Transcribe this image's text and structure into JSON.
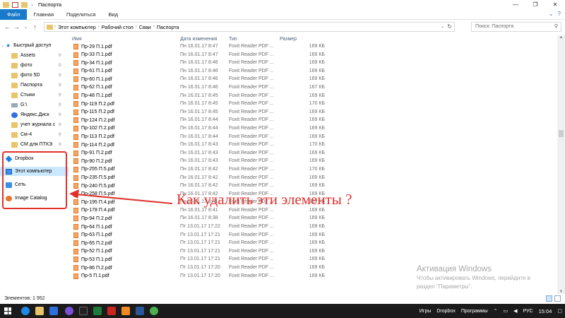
{
  "window": {
    "title": "Паспорта",
    "controls": [
      "—",
      "❐",
      "✕"
    ]
  },
  "ribbon": {
    "tabs": [
      "Файл",
      "Главная",
      "Поделиться",
      "Вид"
    ],
    "right_icons": [
      "⌄",
      "?"
    ]
  },
  "address": {
    "crumbs": [
      "Этот компьютер",
      "Рабочий стол",
      "Сваи",
      "Паспорта"
    ],
    "search_placeholder": "Поиск: Паспорта"
  },
  "nav": {
    "items": [
      {
        "label": "Быстрый доступ",
        "icon": "star-icon",
        "pinned": false,
        "chevron": "⌄"
      },
      {
        "label": "Assets",
        "icon": "folder-icon",
        "pinned": true
      },
      {
        "label": "фото",
        "icon": "folder-icon",
        "pinned": true
      },
      {
        "label": "фото 5D",
        "icon": "folder-icon",
        "pinned": true
      },
      {
        "label": "Паспорта",
        "icon": "folder-icon",
        "pinned": true
      },
      {
        "label": "Стыки",
        "icon": "folder-icon",
        "pinned": true
      },
      {
        "label": "G:\\",
        "icon": "drive-icon",
        "pinned": true
      },
      {
        "label": "Яндекс.Диск",
        "icon": "yandex-disk-icon",
        "pinned": true
      },
      {
        "label": "учет журнала с",
        "icon": "folder-icon",
        "pinned": true
      },
      {
        "label": "См-4",
        "icon": "folder-icon",
        "pinned": true
      },
      {
        "label": "СМ для ПТКЭ",
        "icon": "folder-icon",
        "pinned": true
      },
      {
        "label": "Dropbox",
        "icon": "dropbox-icon",
        "pinned": false,
        "chevron": "›"
      },
      {
        "label": "Этот компьютер",
        "icon": "computer-icon",
        "pinned": false,
        "chevron": "›",
        "selected": true
      },
      {
        "label": "Сеть",
        "icon": "network-icon",
        "pinned": false,
        "chevron": "›"
      },
      {
        "label": "Image Catalog",
        "icon": "image-catalog-icon",
        "pinned": false,
        "chevron": "›"
      }
    ]
  },
  "columns": {
    "name": "Имя",
    "date": "Дата изменения",
    "type": "Тип",
    "size": "Размер"
  },
  "files": [
    {
      "name": "Пр-29 П.1.pdf",
      "date": "Пн 16.01.17 8:47",
      "type": "Foxit Reader PDF ...",
      "size": "169 КБ"
    },
    {
      "name": "Пр-33 П.1.pdf",
      "date": "Пн 16.01.17 8:47",
      "type": "Foxit Reader PDF ...",
      "size": "169 КБ"
    },
    {
      "name": "Пр-34 П.1.pdf",
      "date": "Пн 16.01.17 8:46",
      "type": "Foxit Reader PDF ...",
      "size": "169 КБ"
    },
    {
      "name": "Пр-61 П.1.pdf",
      "date": "Пн 16.01.17 8:46",
      "type": "Foxit Reader PDF ...",
      "size": "169 КБ"
    },
    {
      "name": "Пр-60 П.1.pdf",
      "date": "Пн 16.01.17 8:46",
      "type": "Foxit Reader PDF ...",
      "size": "169 КБ"
    },
    {
      "name": "Пр-62 П.1.pdf",
      "date": "Пн 16.01.17 8:46",
      "type": "Foxit Reader PDF ...",
      "size": "167 КБ"
    },
    {
      "name": "Пр-48 П.1.pdf",
      "date": "Пн 16.01.17 8:45",
      "type": "Foxit Reader PDF ...",
      "size": "169 КБ"
    },
    {
      "name": "Пр-119 П.2.pdf",
      "date": "Пн 16.01.17 8:45",
      "type": "Foxit Reader PDF ...",
      "size": "170 КБ"
    },
    {
      "name": "Пр-115 П.2.pdf",
      "date": "Пн 16.01.17 8:45",
      "type": "Foxit Reader PDF ...",
      "size": "169 КБ"
    },
    {
      "name": "Пр-124 П.2.pdf",
      "date": "Пн 16.01.17 8:44",
      "type": "Foxit Reader PDF ...",
      "size": "169 КБ"
    },
    {
      "name": "Пр-102 П.2.pdf",
      "date": "Пн 16.01.17 8:44",
      "type": "Foxit Reader PDF ...",
      "size": "169 КБ"
    },
    {
      "name": "Пр-113 П.2.pdf",
      "date": "Пн 16.01.17 8:44",
      "type": "Foxit Reader PDF ...",
      "size": "169 КБ"
    },
    {
      "name": "Пр-114 П.2.pdf",
      "date": "Пн 16.01.17 8:43",
      "type": "Foxit Reader PDF ...",
      "size": "170 КБ"
    },
    {
      "name": "Пр-91 П.2.pdf",
      "date": "Пн 16.01.17 8:43",
      "type": "Foxit Reader PDF ...",
      "size": "169 КБ"
    },
    {
      "name": "Пр-90 П.2.pdf",
      "date": "Пн 16.01.17 8:43",
      "type": "Foxit Reader PDF ...",
      "size": "169 КБ"
    },
    {
      "name": "Пр-255 П.5.pdf",
      "date": "Пн 16.01.17 8:42",
      "type": "Foxit Reader PDF ...",
      "size": "170 КБ"
    },
    {
      "name": "Пр-235 П.5.pdf",
      "date": "Пн 16.01.17 8:42",
      "type": "Foxit Reader PDF ...",
      "size": "169 КБ"
    },
    {
      "name": "Пр-240 П.5.pdf",
      "date": "Пн 16.01.17 8:42",
      "type": "Foxit Reader PDF ...",
      "size": "169 КБ"
    },
    {
      "name": "Пр-258 П.5.pdf",
      "date": "Пн 16.01.17 8:42",
      "type": "Foxit Reader PDF ...",
      "size": "169 КБ"
    },
    {
      "name": "Пр-195 П.4.pdf",
      "date": "Пн 16.01.17 8:41",
      "type": "Foxit Reader PDF ...",
      "size": "169 КБ"
    },
    {
      "name": "Пр-178 П.4.pdf",
      "date": "Пн 16.01.17 8:41",
      "type": "Foxit Reader PDF ...",
      "size": "169 КБ"
    },
    {
      "name": "Пр-94 П.2.pdf",
      "date": "Пн 16.01.17 8:38",
      "type": "Foxit Reader PDF ...",
      "size": "169 КБ"
    },
    {
      "name": "Пр-64 П.1.pdf",
      "date": "Пт 13.01.17 17:22",
      "type": "Foxit Reader PDF ...",
      "size": "169 КБ"
    },
    {
      "name": "Пр-63 П.1.pdf",
      "date": "Пт 13.01.17 17:21",
      "type": "Foxit Reader PDF ...",
      "size": "169 КБ"
    },
    {
      "name": "Пр-65 П.2.pdf",
      "date": "Пт 13.01.17 17:21",
      "type": "Foxit Reader PDF ...",
      "size": "169 КБ"
    },
    {
      "name": "Пр-52 П.1.pdf",
      "date": "Пт 13.01.17 17:21",
      "type": "Foxit Reader PDF ...",
      "size": "169 КБ"
    },
    {
      "name": "Пр-53 П.1.pdf",
      "date": "Пт 13.01.17 17:21",
      "type": "Foxit Reader PDF ...",
      "size": "169 КБ"
    },
    {
      "name": "Пр-86 П.2.pdf",
      "date": "Пт 13.01.17 17:20",
      "type": "Foxit Reader PDF ...",
      "size": "169 КБ"
    },
    {
      "name": "Пр-5 П.1.pdf",
      "date": "Пт 13.01.17 17:20",
      "type": "Foxit Reader PDF ...",
      "size": "169 КБ"
    }
  ],
  "annotation": {
    "text": "Как удалить эти элементы ?",
    "color": "#e0312c"
  },
  "watermark": {
    "title": "Активация Windows",
    "line1": "Чтобы активировать Windows, перейдите в",
    "line2": "раздел \"Параметры\"."
  },
  "status": {
    "count": "Элементов: 1 952"
  },
  "taskbar": {
    "icons": [
      "windows-start-icon",
      "edge-icon",
      "explorer-icon",
      "store-icon",
      "viber-icon",
      "game-icon",
      "excel-icon",
      "acrobat-icon",
      "app-icon",
      "word-icon",
      "chrome-icon"
    ],
    "tray_items": [
      "Игры",
      "Dropbox",
      "Программы"
    ],
    "lang": "РУС",
    "time": "15:04"
  },
  "colors": {
    "accent": "#1979ca",
    "selected_bg": "#cce8ff",
    "folder": "#e8c46a"
  }
}
